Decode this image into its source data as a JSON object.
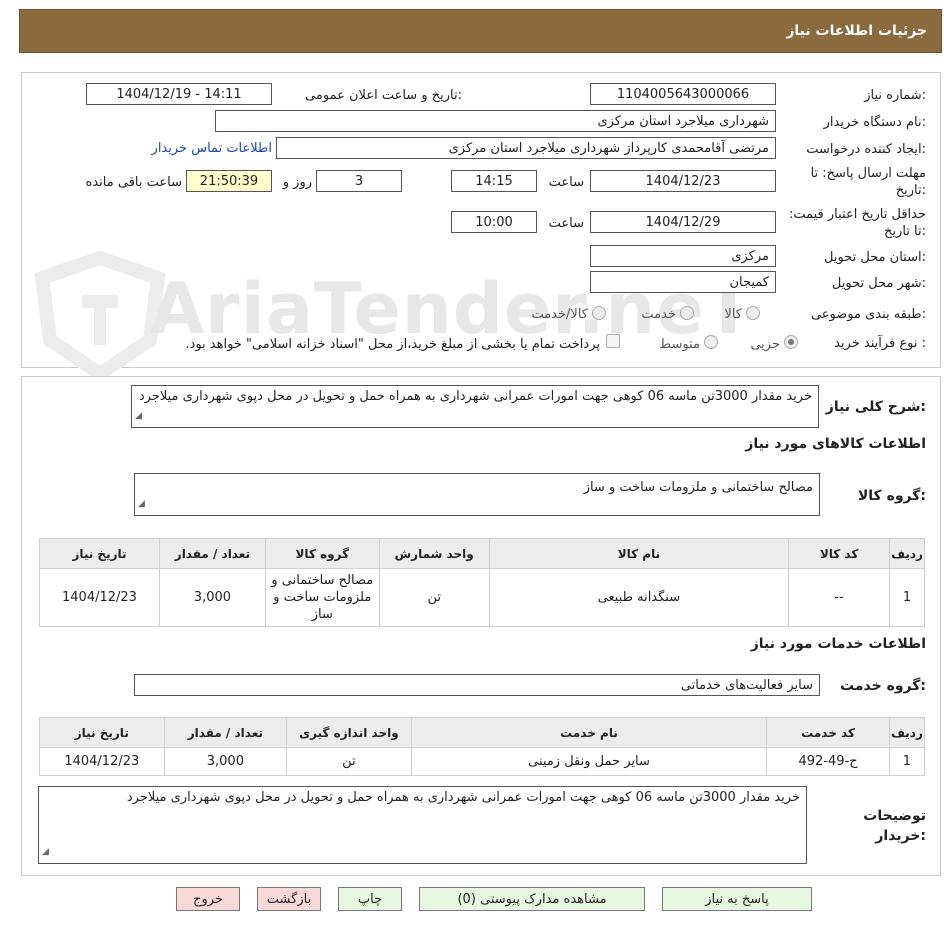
{
  "header": {
    "title": "جزئیات اطلاعات نیاز"
  },
  "watermark": {
    "text": "AriaTender.neT"
  },
  "fields": {
    "need_number_label": "شماره نیاز:",
    "need_number": "1104005643000066",
    "announce_label": "تاریخ و ساعت اعلان عمومی:",
    "announce_value": "1404/12/19 - 14:11",
    "buyer_org_label": "نام دستگاه خریدار:",
    "buyer_org": "شهرداری میلاجرد استان مرکزی",
    "creator_label": "ایجاد کننده درخواست:",
    "creator": "مرتضی  آقامحمدی  کارپرداز  شهرداری میلاجرد استان مرکزی",
    "contact_link": "اطلاعات تماس خریدار",
    "deadline_label": "مهلت ارسال پاسخ: تا تاریخ:",
    "deadline_date": "1404/12/23",
    "time_label": "ساعت",
    "deadline_time": "14:15",
    "days_value": "3",
    "days_label": "روز و",
    "remaining_time": "21:50:39",
    "remaining_label": "ساعت باقی مانده",
    "validity_label": "حداقل تاریخ اعتبار قیمت: تا تاریخ:",
    "validity_date": "1404/12/29",
    "validity_time_label": "ساعت",
    "validity_time": "10:00",
    "province_label": "استان محل تحویل:",
    "province": "مرکزی",
    "city_label": "شهر محل تحویل:",
    "city": "کمیجان",
    "category_label": "طبقه بندی موضوعی:",
    "category_options": [
      "کالا",
      "خدمت",
      "کالا/خدمت"
    ],
    "process_label": "نوع فرآیند خرید :",
    "process_options": [
      "جزیی",
      "متوسط"
    ],
    "payment_note": "پرداخت تمام یا بخشی از مبلغ خرید،از محل \"اسناد خزانه اسلامی\" خواهد بود."
  },
  "summary": {
    "label": "شرح کلی نیاز:",
    "text": "خرید مقدار 3000تن ماسه 06 کوهی جهت امورات عمرانی شهرداری به همراه حمل و تحویل در محل دپوی شهرداری میلاجرد"
  },
  "goods": {
    "section_title": "اطلاعات کالاهای مورد نیاز",
    "group_label": "گروه کالا:",
    "group_value": "مصالح ساختمانی و ملزومات ساخت و ساز",
    "columns": [
      "ردیف",
      "کد کالا",
      "نام کالا",
      "واحد شمارش",
      "گروه کالا",
      "تعداد / مقدار",
      "تاریخ نیاز"
    ],
    "rows": [
      [
        "1",
        "--",
        "سنگدانه طبیعی",
        "تن",
        "مصالح ساختمانی و ملزومات ساخت و ساز",
        "3,000",
        "1404/12/23"
      ]
    ]
  },
  "services": {
    "section_title": "اطلاعات خدمات مورد نیاز",
    "group_label": "گروه خدمت:",
    "group_value": "سایر فعالیت‌های خدماتی",
    "columns": [
      "ردیف",
      "کد خدمت",
      "نام خدمت",
      "واحد اندازه گیری",
      "تعداد / مقدار",
      "تاریخ نیاز"
    ],
    "rows": [
      [
        "1",
        "ح-49-492",
        "سایر حمل ونقل زمینی",
        "تن",
        "3,000",
        "1404/12/23"
      ]
    ]
  },
  "buyer_notes": {
    "label": "توضیحات خریدار:",
    "text": "خرید مقدار 3000تن ماسه 06 کوهی جهت امورات عمرانی شهرداری به همراه حمل و تحویل در محل دپوی شهرداری میلاجرد"
  },
  "buttons": {
    "reply": "پاسخ به نیاز",
    "attachments": "مشاهده مدارک پیوستی (0)",
    "print": "چاپ",
    "back": "بازگشت",
    "exit": "خروج"
  },
  "colors": {
    "titlebar": "#8b6a3e",
    "link": "#1a44c6",
    "highlight": "#ffffcc"
  }
}
